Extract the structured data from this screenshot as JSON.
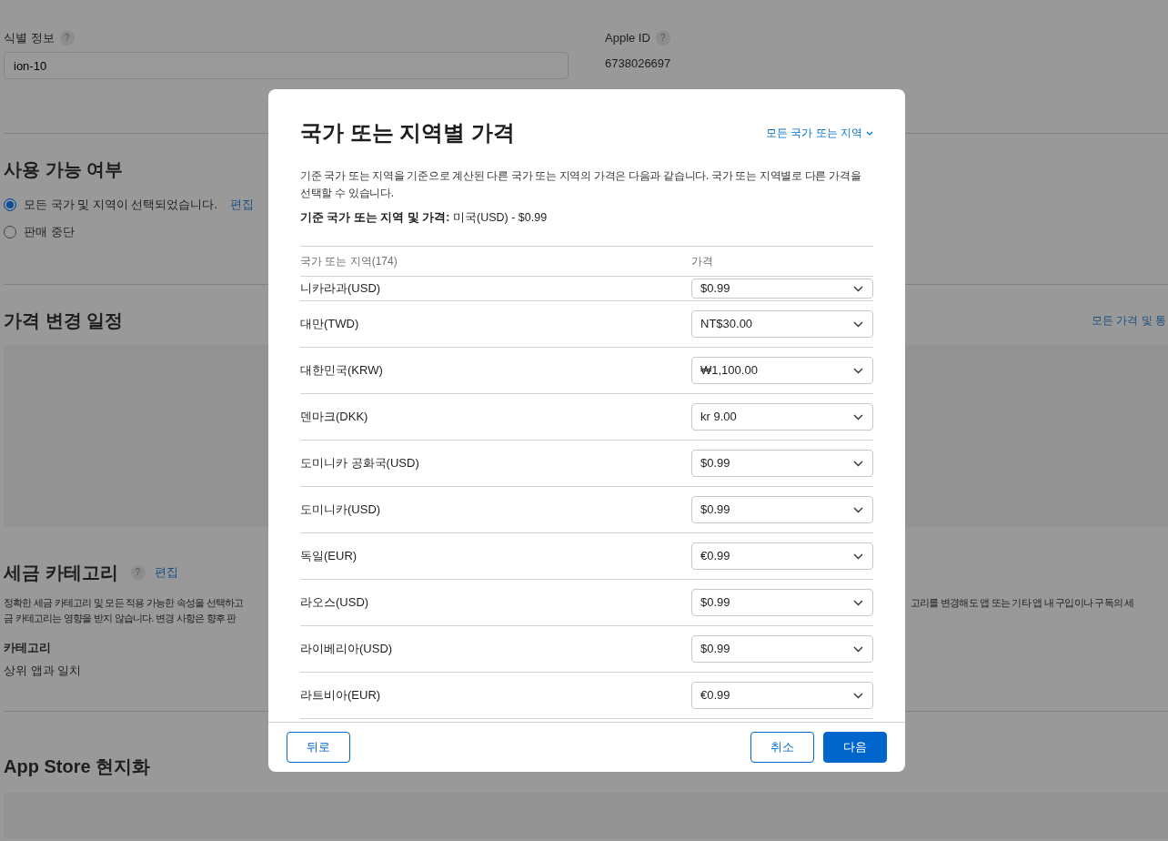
{
  "background": {
    "identity": {
      "label": "식별 정보",
      "help": "?",
      "value": "ion-10"
    },
    "apple_id": {
      "label": "Apple ID",
      "help": "?",
      "value": "6738026697"
    },
    "availability": {
      "title": "사용 가능 여부",
      "options": [
        {
          "label": "모든 국가 및 지역이 선택되었습니다.",
          "link": "편집",
          "selected": true
        },
        {
          "label": "판매 중단",
          "selected": false
        }
      ]
    },
    "price_schedule": {
      "title": "가격 변경 일정",
      "link": "모든 가격 및 통"
    },
    "tax": {
      "title": "세금 카테고리",
      "help": "?",
      "link": "편집",
      "description_left": [
        "정확한 세금 카테고리 및 모든 적용 가능한 속성을 선택하고",
        "금 카테고리는 영향을 받지 않습니다. 변경 사항은 향후 판"
      ],
      "description_right": "고리를 변경해도 앱 또는 기타 앱 내 구입이나 구독의 세",
      "category_label": "카테고리",
      "category_value": "상위 앱과 일치"
    },
    "localization": {
      "title": "App Store 현지화"
    }
  },
  "dialog": {
    "title": "국가 또는 지역별 가격",
    "filter": "모든 국가 또는 지역",
    "description": "기준 국가 또는 지역을 기준으로 계산된 다른 국가 또는 지역의 가격은 다음과 같습니다. 국가 또는 지역별로 다른 가격을 선택할 수 있습니다.",
    "base_label": "기준 국가 또는 지역 및 가격:",
    "base_value": "미국(USD) - $0.99",
    "columns": [
      "국가 또는 지역(174)",
      "가격"
    ],
    "rows": [
      {
        "region": "니카라과(USD)",
        "price": "$0.99"
      },
      {
        "region": "대만(TWD)",
        "price": "NT$30.00"
      },
      {
        "region": "대한민국(KRW)",
        "price": "₩1,100.00"
      },
      {
        "region": "덴마크(DKK)",
        "price": "kr 9.00"
      },
      {
        "region": "도미니카 공화국(USD)",
        "price": "$0.99"
      },
      {
        "region": "도미니카(USD)",
        "price": "$0.99"
      },
      {
        "region": "독일(EUR)",
        "price": "€0.99"
      },
      {
        "region": "라오스(USD)",
        "price": "$0.99"
      },
      {
        "region": "라이베리아(USD)",
        "price": "$0.99"
      },
      {
        "region": "라트비아(EUR)",
        "price": "€0.99"
      }
    ],
    "buttons": [
      {
        "label": "뒤로",
        "kind": "outline"
      },
      {
        "label": "취소",
        "kind": "outline"
      },
      {
        "label": "다음",
        "kind": "primary"
      }
    ]
  }
}
